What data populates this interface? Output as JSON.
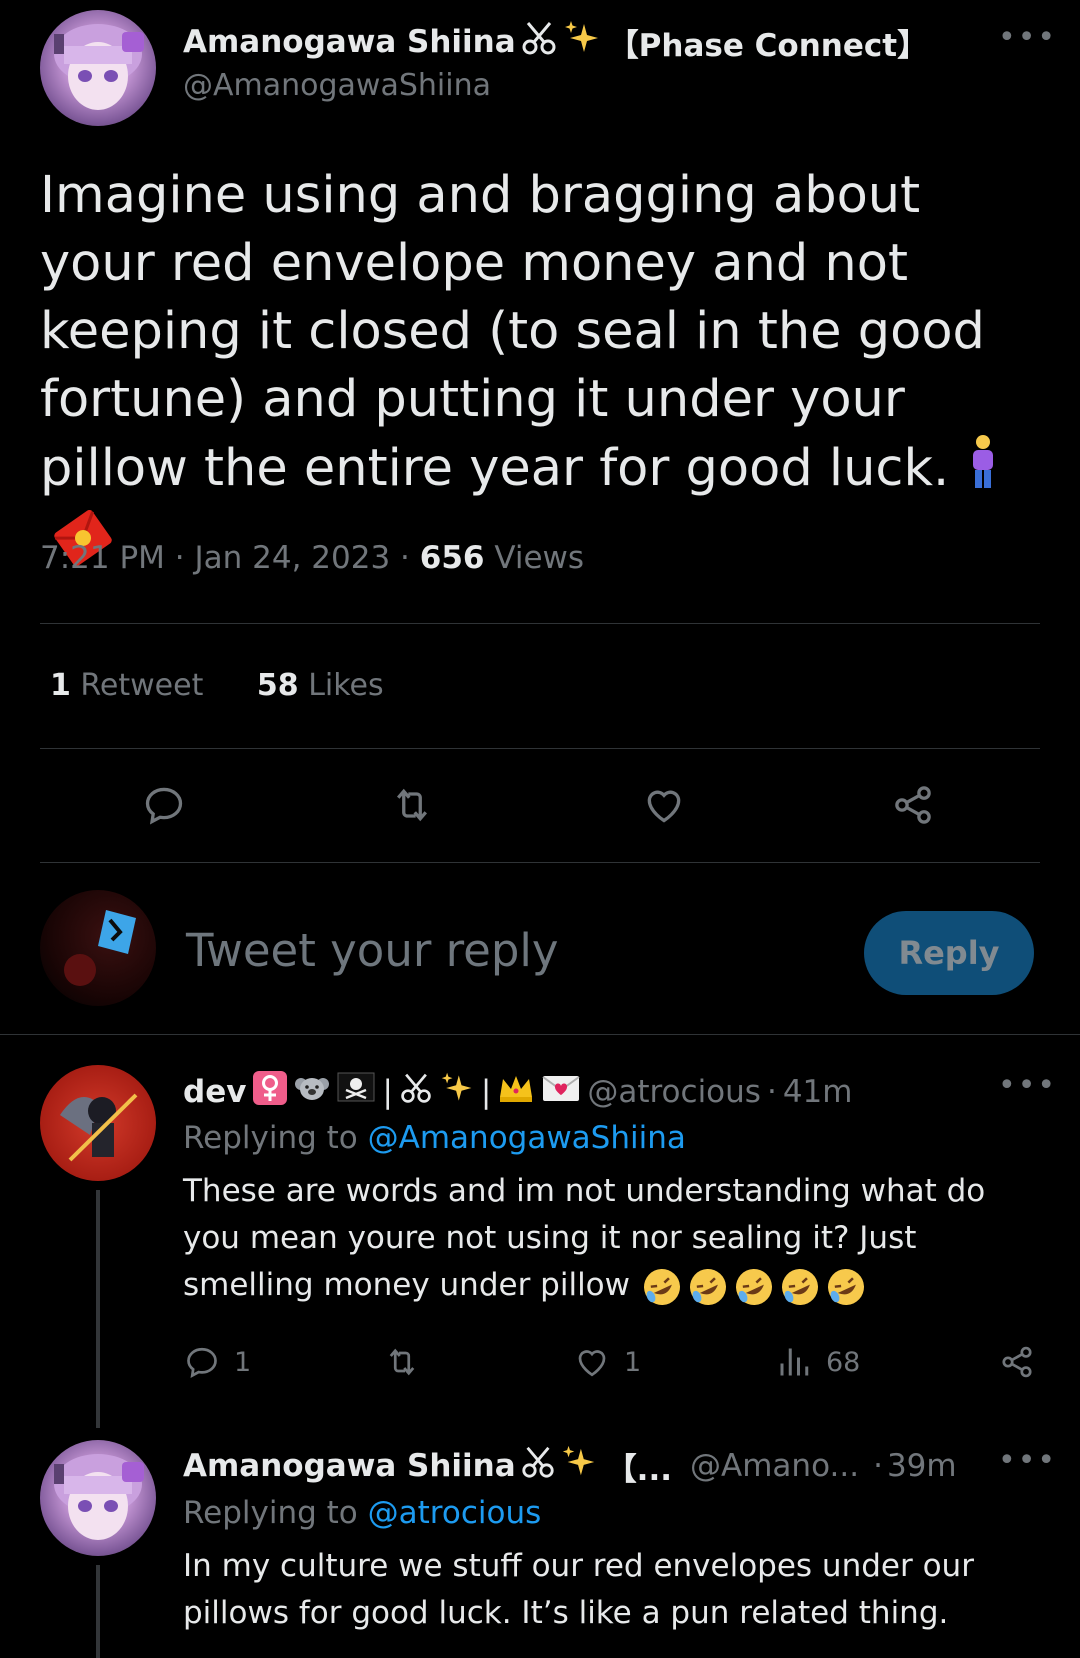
{
  "main_tweet": {
    "author_name": "Amanogawa Shiina",
    "author_suffix": "【Phase Connect】",
    "handle": "@AmanogawaShiina",
    "text": "Imagine using and bragging about your red envelope money and not keeping it closed (to seal in the good fortune) and putting it under your pillow the entire year for good luck.",
    "time": "7:21 PM",
    "date": "Jan 24, 2023",
    "sep": "·",
    "views_count": "656",
    "views_label": "Views",
    "retweets_count": "1",
    "retweets_label": "Retweet",
    "likes_count": "58",
    "likes_label": "Likes"
  },
  "reply_box": {
    "placeholder": "Tweet your reply",
    "button_label": "Reply"
  },
  "replies": [
    {
      "author_name": "dev",
      "author_tags": "| ✂ ✨ | ",
      "handle": "@atrocious",
      "time": "41m",
      "sep": "·",
      "replying_prefix": "Replying to",
      "replying_to": "@AmanogawaShiina",
      "text": "These are words and im not understanding what do you mean youre not using it nor sealing it? Just smelling money under pillow",
      "reply_count": "1",
      "like_count": "1",
      "views_count": "68"
    },
    {
      "author_name": "Amanogawa Shiina",
      "author_suffix": "【...",
      "handle": "@Amano...",
      "time": "39m",
      "sep": "·",
      "replying_prefix": "Replying to",
      "replying_to": "@atrocious",
      "text": "In my culture we stuff our red envelopes under our pillows for good luck. It’s like a pun related thing."
    }
  ],
  "colors": {
    "background": "#000000",
    "text": "#e7e9ea",
    "muted": "#71767b",
    "link": "#1d9bf0",
    "reply_button": "#0f4e78",
    "divider": "#2f3336"
  }
}
